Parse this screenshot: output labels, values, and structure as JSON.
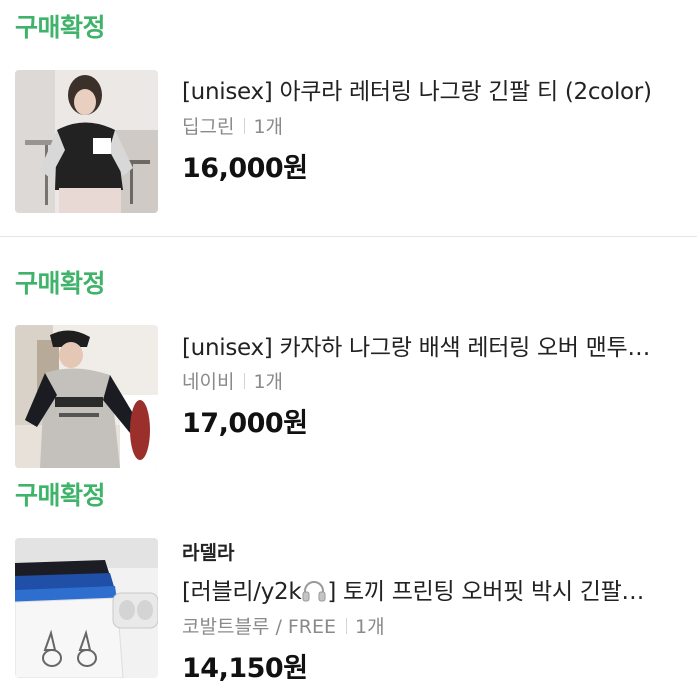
{
  "orders": [
    {
      "status": "구매확정",
      "title": "[unisex] 아쿠라 레터링 나그랑 긴팔 티 (2color)",
      "option": "딥그린",
      "quantity": "1개",
      "price": "16,000원"
    },
    {
      "status": "구매확정",
      "title": "[unisex] 카자하 나그랑 배색 레터링 오버 맨투…",
      "option": "네이비",
      "quantity": "1개",
      "price": "17,000원"
    },
    {
      "status": "구매확정",
      "seller": "라델라",
      "title_prefix": "[러블리/y2k",
      "title_icon": "headphones-icon",
      "title_suffix": "] 토끼 프린팅 오버핏 박시 긴팔…",
      "option": "코발트블루 / FREE",
      "quantity": "1개",
      "price": "14,150원"
    }
  ],
  "colors": {
    "status_green": "#3fb36a",
    "divider": "#e6e6e6",
    "muted_text": "#8a8a8a"
  }
}
